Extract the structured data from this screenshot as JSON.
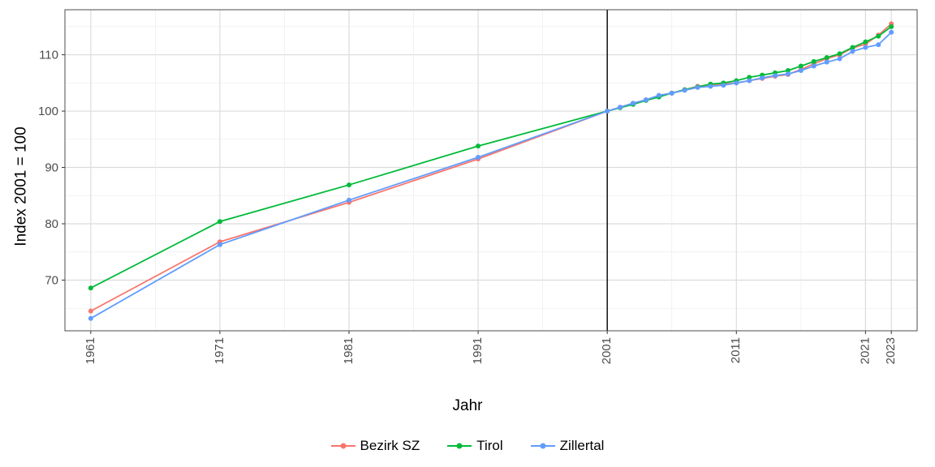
{
  "axis": {
    "y_title": "Index 2001 = 100",
    "x_title": "Jahr",
    "y_ticks": [
      70,
      80,
      90,
      100,
      110
    ],
    "x_ticks": [
      1961,
      1971,
      1981,
      1991,
      2001,
      2011,
      2021,
      2023
    ]
  },
  "legend": {
    "items": [
      {
        "label": "Bezirk SZ",
        "color": "#F8766D"
      },
      {
        "label": "Tirol",
        "color": "#00BA38"
      },
      {
        "label": "Zillertal",
        "color": "#619CFF"
      }
    ]
  },
  "chart_data": {
    "type": "line",
    "xlabel": "Jahr",
    "ylabel": "Index 2001 = 100",
    "xlim": [
      1959,
      2025
    ],
    "ylim": [
      61,
      118
    ],
    "reference_line_x": 2001,
    "x_decadal": [
      1961,
      1971,
      1981,
      1991,
      2001
    ],
    "x_annual": [
      2001,
      2002,
      2003,
      2004,
      2005,
      2006,
      2007,
      2008,
      2009,
      2010,
      2011,
      2012,
      2013,
      2014,
      2015,
      2016,
      2017,
      2018,
      2019,
      2020,
      2021,
      2022,
      2023
    ],
    "series": [
      {
        "name": "Bezirk SZ",
        "color": "#F8766D",
        "decadal_values": [
          64.5,
          76.8,
          83.8,
          91.5,
          100.0
        ],
        "annual_values": [
          100.0,
          100.7,
          101.4,
          102.0,
          102.7,
          103.2,
          103.8,
          104.4,
          104.7,
          104.8,
          105.0,
          105.4,
          105.8,
          106.2,
          106.5,
          107.4,
          108.4,
          109.3,
          110.0,
          111.2,
          111.9,
          113.5,
          115.5
        ]
      },
      {
        "name": "Tirol",
        "color": "#00BA38",
        "decadal_values": [
          68.6,
          80.4,
          86.9,
          93.8,
          100.0
        ],
        "annual_values": [
          100.0,
          100.6,
          101.2,
          101.9,
          102.5,
          103.2,
          103.8,
          104.3,
          104.8,
          105.0,
          105.4,
          106.0,
          106.4,
          106.8,
          107.2,
          108.0,
          108.8,
          109.5,
          110.2,
          111.3,
          112.3,
          113.3,
          115.0
        ]
      },
      {
        "name": "Zillertal",
        "color": "#619CFF",
        "decadal_values": [
          63.2,
          76.3,
          84.2,
          91.8,
          100.0
        ],
        "annual_values": [
          100.0,
          100.7,
          101.4,
          102.0,
          102.8,
          103.2,
          103.7,
          104.2,
          104.4,
          104.6,
          105.0,
          105.4,
          105.9,
          106.3,
          106.6,
          107.2,
          108.0,
          108.7,
          109.3,
          110.6,
          111.3,
          111.8,
          114.0
        ]
      }
    ]
  }
}
